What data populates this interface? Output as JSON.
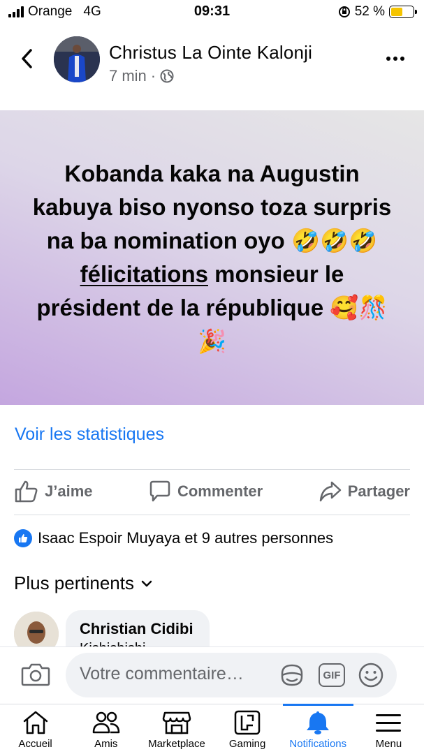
{
  "status_bar": {
    "carrier": "Orange",
    "network": "4G",
    "time": "09:31",
    "battery": "52 %",
    "battery_level": 0.52
  },
  "post": {
    "author": "Christus La Ointe Kalonji",
    "time_ago": "7 min",
    "separator": "·",
    "audience_icon": "globe-icon",
    "text_before": "Kobanda kaka na Augustin kabuya biso nyonso toza surpris na ba nomination oyo 🤣🤣🤣 ",
    "text_link": "félicitations",
    "text_after": " monsieur le président de la république 🥰🎊🎉",
    "background_colors": [
      "#e6e6e6",
      "#ddd6e8",
      "#c4a6df"
    ]
  },
  "stats_link": "Voir les statistiques",
  "actions": {
    "like": "J’aime",
    "comment": "Commenter",
    "share": "Partager"
  },
  "reactions": {
    "summary": "Isaac Espoir Muyaya et 9 autres personnes"
  },
  "comments": {
    "sort_label": "Plus pertinents",
    "preview": {
      "name": "Christian Cidibi",
      "text": "Kishishishi"
    }
  },
  "composer": {
    "placeholder": "Votre commentaire…",
    "gif_label": "GIF"
  },
  "tab_bar": {
    "items": [
      {
        "label": "Accueil",
        "icon": "home-icon"
      },
      {
        "label": "Amis",
        "icon": "friends-icon"
      },
      {
        "label": "Marketplace",
        "icon": "marketplace-icon"
      },
      {
        "label": "Gaming",
        "icon": "gaming-icon"
      },
      {
        "label": "Notifications",
        "icon": "bell-icon"
      },
      {
        "label": "Menu",
        "icon": "menu-icon"
      }
    ],
    "active": "Notifications"
  },
  "colors": {
    "accent": "#1877f2",
    "secondary_text": "#65676b",
    "battery": "#f5c400"
  }
}
